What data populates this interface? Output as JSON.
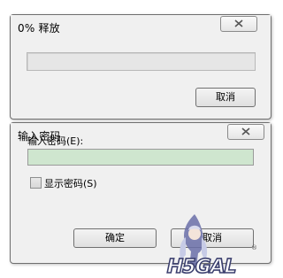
{
  "extract_dialog": {
    "title": "0% 释放",
    "progress_percent": 0,
    "cancel_label": "取消"
  },
  "password_dialog": {
    "title": "输入密码",
    "prompt_label": "输入密码(E):",
    "password_value": "",
    "show_password_label": "显示密码(S)",
    "show_password_checked": false,
    "ok_label": "确定",
    "cancel_label": "取消"
  },
  "watermark": {
    "text": "H5GAL"
  },
  "colors": {
    "dialog_bg": "#f0f0f0",
    "input_bg": "#cfe6cf",
    "progress_fill": "#06b025"
  }
}
